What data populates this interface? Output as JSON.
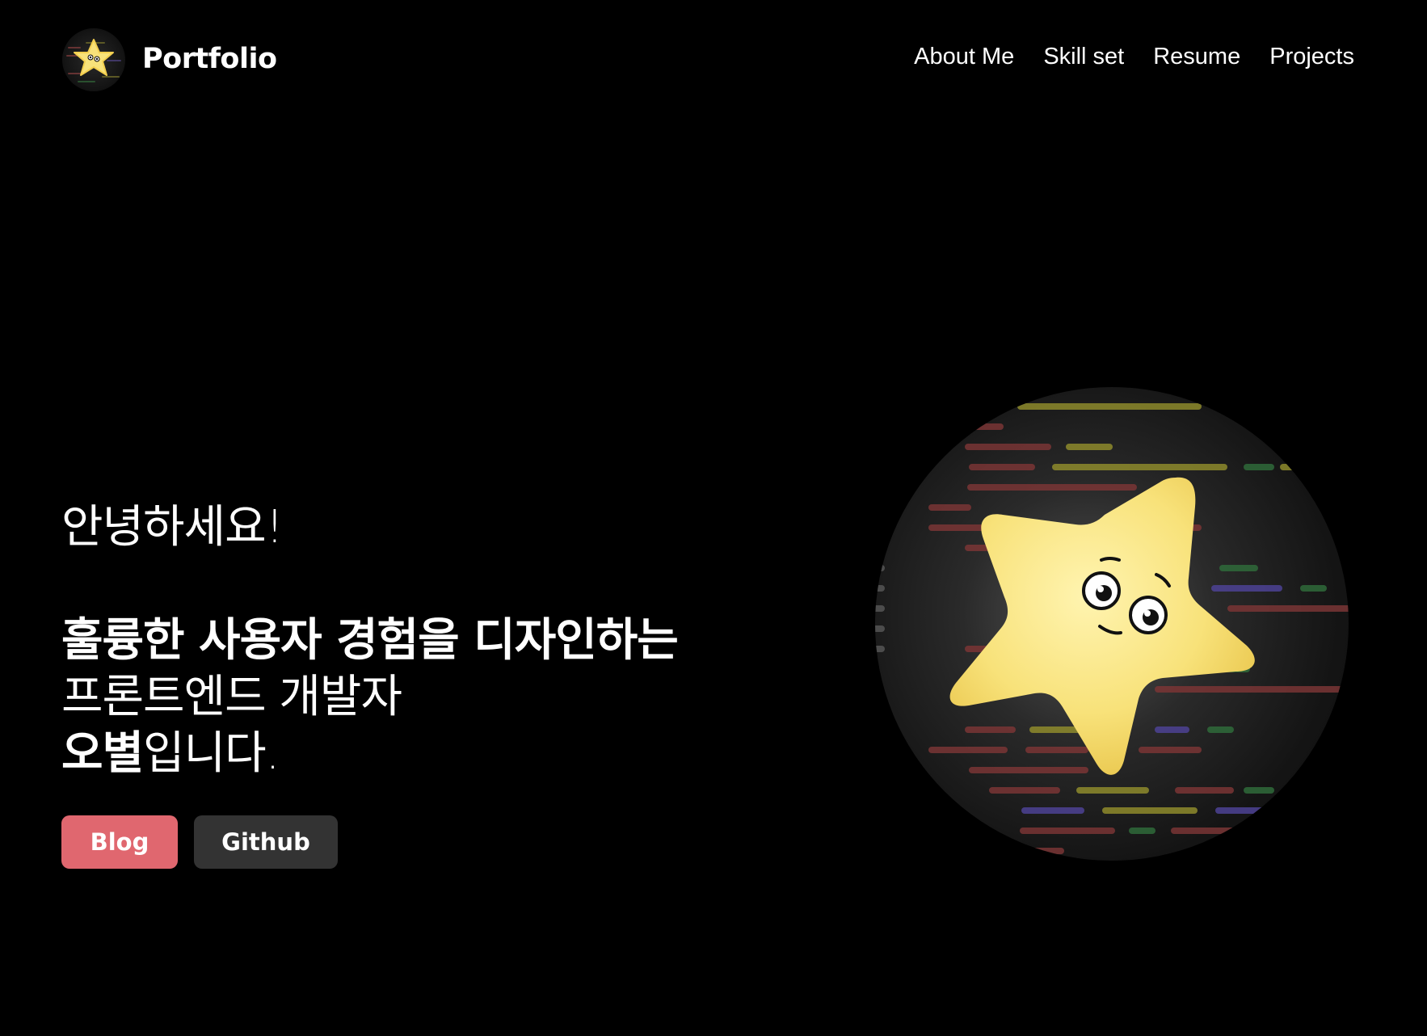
{
  "header": {
    "logo_text": "Portfolio",
    "logo_icon": "star-character-icon",
    "nav": [
      {
        "label": "About Me"
      },
      {
        "label": "Skill set"
      },
      {
        "label": "Resume"
      },
      {
        "label": "Projects"
      }
    ]
  },
  "hero": {
    "greeting": "안녕하세요!",
    "line1": "훌륭한 사용자 경험을 디자인하는",
    "line2": "프론트엔드 개발자",
    "line3_name": "오별",
    "line3_rest": "입니다.",
    "buttons": {
      "blog": "Blog",
      "github": "Github"
    },
    "image_icon": "star-character-icon"
  },
  "colors": {
    "background": "#000000",
    "blog_button": "#e0676f",
    "github_button": "#333333",
    "star": "#f8e27a"
  }
}
